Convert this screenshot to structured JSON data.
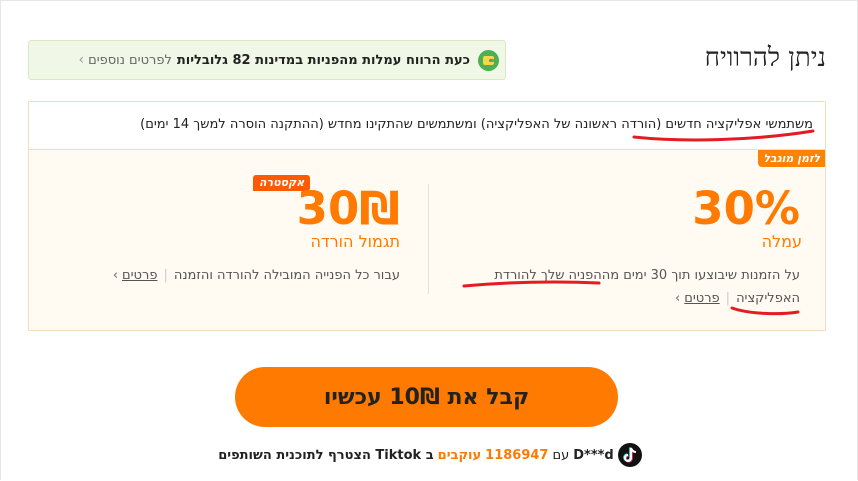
{
  "title": "ניתן להרוויח",
  "banner": {
    "strong_text": "כעת הרווח עמלות מהפניות במדינות 82 גלובליות",
    "link_text": "לפרטים נוספים",
    "icon": "wallet-icon",
    "chevron": "›"
  },
  "card": {
    "audience_highlight": "משתמשי אפליקציה חדשים",
    "audience_rest": " (הורדה ראשונה של האפליקציה) ומשתמשים שהתקינו מחדש (ההתקנה הוסרה למשך 14 ימים)",
    "ribbon": "לזמן מוגבל",
    "commission": {
      "value": "30%",
      "label": "עמלה",
      "desc_line1": "על הזמנות שיבוצעו תוך 30 ימים מההפניה שלך להורדת",
      "desc_line2_text": "האפליקציה",
      "details_link": "פרטים"
    },
    "bonus": {
      "badge": "אקסטרה",
      "value": "30₪",
      "label": "תגמול הורדה",
      "desc": "עבור כל הפנייה המובילה להורדה והזמנה",
      "details_link": "פרטים"
    }
  },
  "cta": {
    "label": "קבל את 10₪ עכשיו"
  },
  "footer": {
    "icon": "tiktok-icon",
    "user": "D***d",
    "with": "עם",
    "followers_count": "1186947",
    "followers_word": "עוקבים",
    "joined_text": "ב Tiktok הצטרף לתוכנית השותפים"
  },
  "colors": {
    "accent": "#ff7a00",
    "banner_bg": "#f1f7e6",
    "annotation": "#e31b23"
  }
}
